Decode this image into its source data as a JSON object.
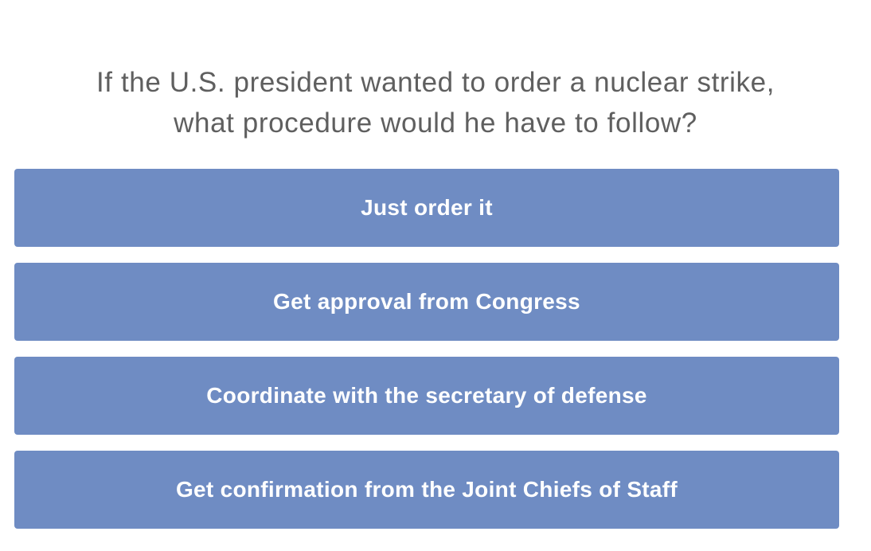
{
  "question": {
    "line1": "If the U.S. president wanted to order a nuclear strike,",
    "line2": "what procedure would he have to follow?"
  },
  "answers": [
    {
      "label": "Just order it"
    },
    {
      "label": "Get approval from Congress"
    },
    {
      "label": "Coordinate with the secretary of defense"
    },
    {
      "label": "Get confirmation from the Joint Chiefs of Staff"
    }
  ],
  "colors": {
    "answer_background": "#6f8cc3",
    "answer_text": "#ffffff",
    "question_text": "#5f5f5f"
  }
}
